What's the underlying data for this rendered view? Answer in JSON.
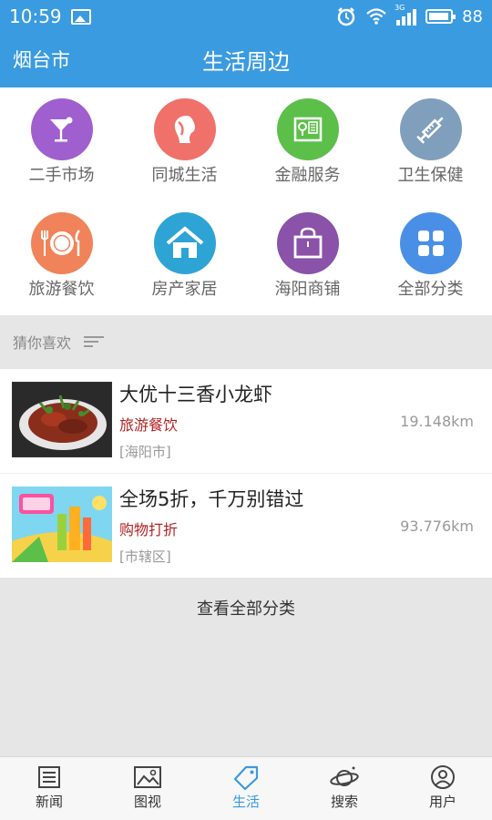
{
  "status_bar": {
    "time": "10:59",
    "network": "3G",
    "battery": "88"
  },
  "header": {
    "city": "烟台市",
    "title": "生活周边"
  },
  "categories": [
    {
      "label": "二手市场",
      "icon": "cocktail-icon",
      "color": "#a05fcf"
    },
    {
      "label": "同城生活",
      "icon": "person-profile-icon",
      "color": "#f0716a"
    },
    {
      "label": "金融服务",
      "icon": "safe-icon",
      "color": "#5cbf4a"
    },
    {
      "label": "卫生保健",
      "icon": "syringe-icon",
      "color": "#7f9fbd"
    },
    {
      "label": "旅游餐饮",
      "icon": "plate-cutlery-icon",
      "color": "#f0835a"
    },
    {
      "label": "房产家居",
      "icon": "house-icon",
      "color": "#2ea4d5"
    },
    {
      "label": "海阳商铺",
      "icon": "shopping-bag-icon",
      "color": "#8a52a8"
    },
    {
      "label": "全部分类",
      "icon": "grid-icon",
      "color": "#4a8fe6"
    }
  ],
  "section": {
    "title": "猜你喜欢"
  },
  "listings": [
    {
      "title": "大优十三香小龙虾",
      "category": "旅游餐饮",
      "distance": "19.148km",
      "district": "[海阳市]"
    },
    {
      "title": "全场5折，千万别错过",
      "category": "购物打折",
      "distance": "93.776km",
      "district": "[市辖区]"
    }
  ],
  "view_all": "查看全部分类",
  "nav": [
    {
      "label": "新闻",
      "icon": "newspaper-icon"
    },
    {
      "label": "图视",
      "icon": "picture-icon"
    },
    {
      "label": "生活",
      "icon": "tag-icon"
    },
    {
      "label": "搜索",
      "icon": "planet-icon"
    },
    {
      "label": "用户",
      "icon": "user-icon"
    }
  ]
}
